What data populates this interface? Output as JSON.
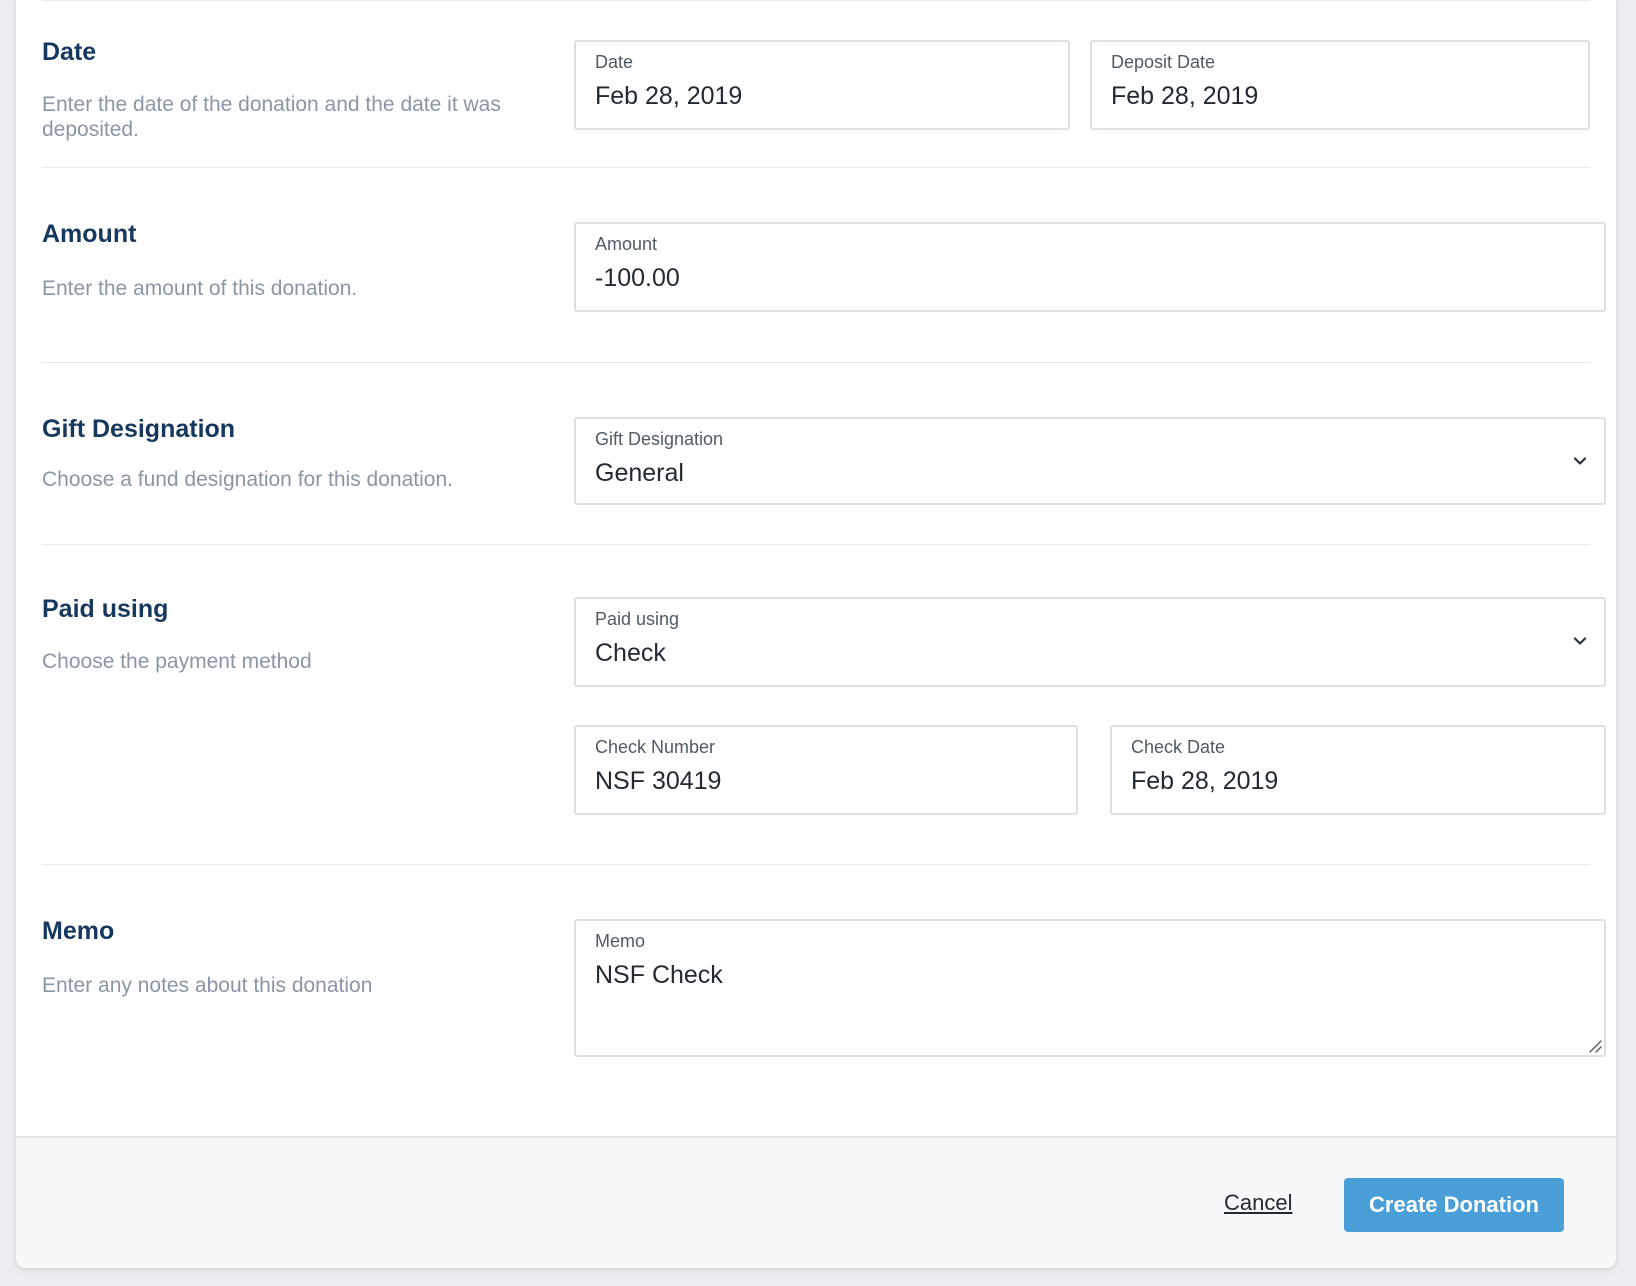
{
  "sections": {
    "date": {
      "title": "Date",
      "description": "Enter the date of the donation and the date it was deposited.",
      "fields": {
        "date": {
          "label": "Date",
          "value": "Feb 28, 2019"
        },
        "deposit_date": {
          "label": "Deposit Date",
          "value": "Feb 28, 2019"
        }
      }
    },
    "amount": {
      "title": "Amount",
      "description": "Enter the amount of this donation.",
      "fields": {
        "amount": {
          "label": "Amount",
          "value": "-100.00"
        }
      }
    },
    "gift_designation": {
      "title": "Gift Designation",
      "description": "Choose a fund designation for this donation.",
      "fields": {
        "gift_designation": {
          "label": "Gift Designation",
          "value": "General"
        }
      }
    },
    "paid_using": {
      "title": "Paid using",
      "description": "Choose the payment method",
      "fields": {
        "paid_using": {
          "label": "Paid using",
          "value": "Check"
        },
        "check_number": {
          "label": "Check Number",
          "value": "NSF 30419"
        },
        "check_date": {
          "label": "Check Date",
          "value": "Feb 28, 2019"
        }
      }
    },
    "memo": {
      "title": "Memo",
      "description": "Enter any notes about this donation",
      "fields": {
        "memo": {
          "label": "Memo",
          "value": "NSF Check"
        }
      }
    }
  },
  "footer": {
    "cancel_label": "Cancel",
    "create_label": "Create Donation"
  },
  "icons": {
    "select_chevron": "chevron-down-icon",
    "textarea_resize": "resize-handle-icon"
  },
  "colors": {
    "heading": "#17385e",
    "description": "#8896a6",
    "primary_button": "#4a9fd9"
  }
}
